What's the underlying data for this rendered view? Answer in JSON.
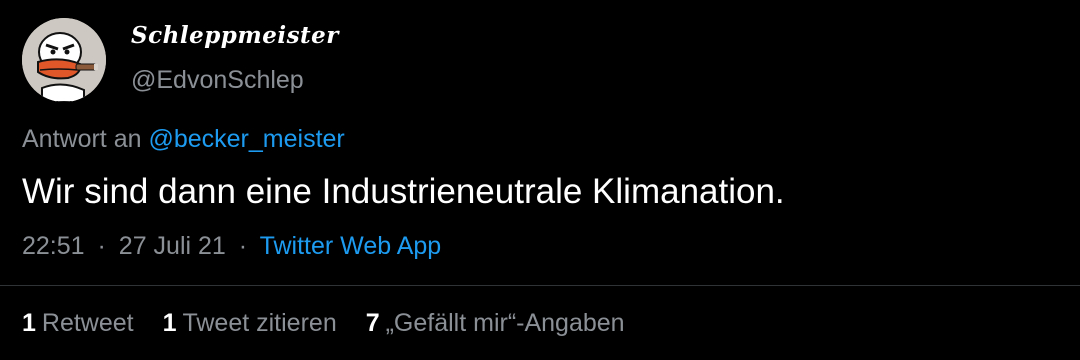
{
  "author": {
    "display_name": "Schleppmeister",
    "handle": "@EdvonSchlep",
    "avatar_icon": "cartoon-duck-with-cigar-avatar"
  },
  "reply": {
    "prefix": "Antwort an",
    "mention": "@becker_meister"
  },
  "tweet": {
    "text": "Wir sind dann eine Industrieneutrale Klimanation."
  },
  "meta": {
    "time": "22:51",
    "date": "27 Juli 21",
    "source": "Twitter Web App",
    "separator": "·"
  },
  "stats": {
    "retweets_count": "1",
    "retweets_label": "Retweet",
    "quotes_count": "1",
    "quotes_label": "Tweet zitieren",
    "likes_count": "7",
    "likes_label": "„Gefällt mir“-Angaben"
  },
  "colors": {
    "background": "#000000",
    "link": "#1d9bf0",
    "secondary_text": "#8b9096",
    "primary_text": "#ffffff"
  }
}
